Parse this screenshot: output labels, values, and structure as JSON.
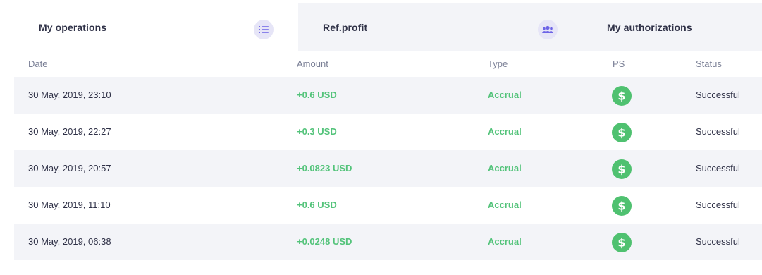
{
  "tabs": [
    {
      "label": "My operations",
      "icon": "list-icon",
      "active": true
    },
    {
      "label": "Ref.profit",
      "icon": "group-icon",
      "active": false
    },
    {
      "label": "My authorizations",
      "active": false
    }
  ],
  "table": {
    "headers": {
      "date": "Date",
      "amount": "Amount",
      "type": "Type",
      "ps": "PS",
      "status": "Status"
    },
    "rows": [
      {
        "date": "30 May, 2019, 23:10",
        "amount": "+0.6 USD",
        "type": "Accrual",
        "ps": "dollar-icon",
        "status": "Successful"
      },
      {
        "date": "30 May, 2019, 22:27",
        "amount": "+0.3 USD",
        "type": "Accrual",
        "ps": "dollar-icon",
        "status": "Successful"
      },
      {
        "date": "30 May, 2019, 20:57",
        "amount": "+0.0823 USD",
        "type": "Accrual",
        "ps": "dollar-icon",
        "status": "Successful"
      },
      {
        "date": "30 May, 2019, 11:10",
        "amount": "+0.6 USD",
        "type": "Accrual",
        "ps": "dollar-icon",
        "status": "Successful"
      },
      {
        "date": "30 May, 2019, 06:38",
        "amount": "+0.0248 USD",
        "type": "Accrual",
        "ps": "dollar-icon",
        "status": "Successful"
      }
    ]
  },
  "colors": {
    "accent": "#6c63e6",
    "positive": "#53c37a",
    "ps_badge": "#4fc170"
  }
}
